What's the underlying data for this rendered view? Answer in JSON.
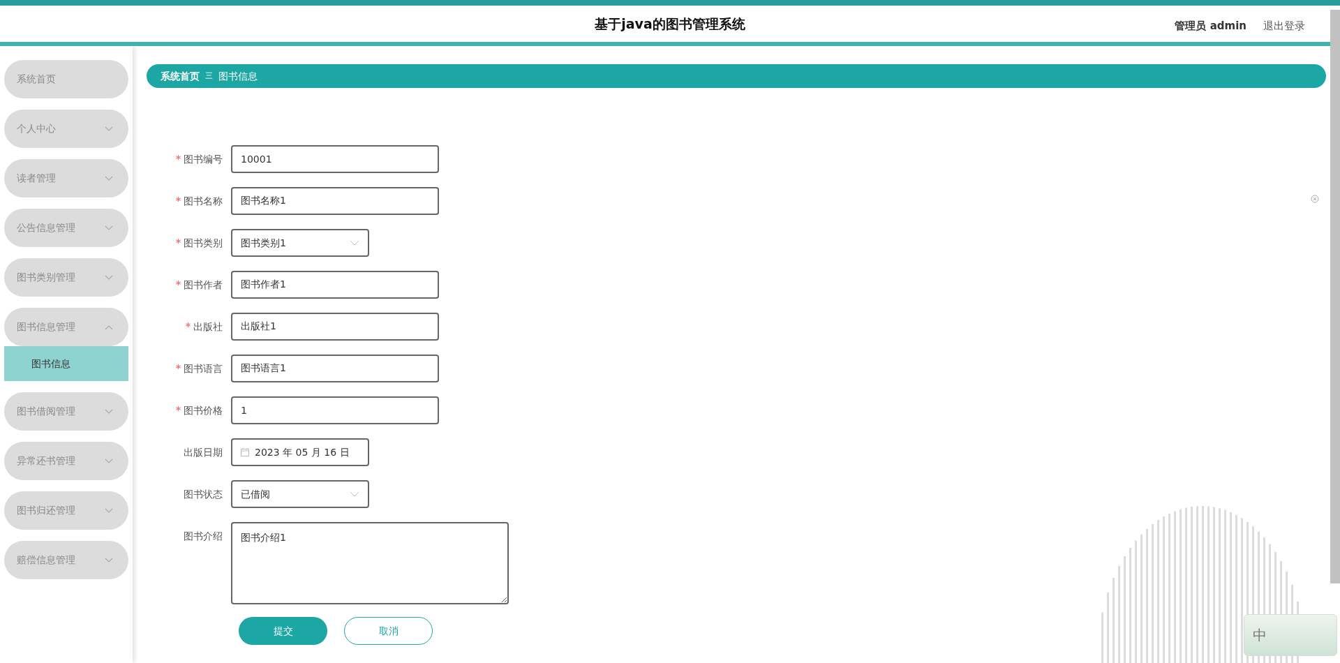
{
  "header": {
    "title": "基于java的图书管理系统",
    "user": "管理员 admin",
    "logout": "退出登录"
  },
  "sidebar": {
    "items": [
      {
        "label": "系统首页",
        "kind": "link"
      },
      {
        "label": "个人中心",
        "kind": "menu",
        "expanded": false
      },
      {
        "label": "读者管理",
        "kind": "menu",
        "expanded": false
      },
      {
        "label": "公告信息管理",
        "kind": "menu",
        "expanded": false
      },
      {
        "label": "图书类别管理",
        "kind": "menu",
        "expanded": false
      },
      {
        "label": "图书信息管理",
        "kind": "menu",
        "expanded": true,
        "children": [
          {
            "label": "图书信息",
            "selected": true
          }
        ]
      },
      {
        "label": "图书借阅管理",
        "kind": "menu",
        "expanded": false
      },
      {
        "label": "异常还书管理",
        "kind": "menu",
        "expanded": false
      },
      {
        "label": "图书归还管理",
        "kind": "menu",
        "expanded": false
      },
      {
        "label": "赔偿信息管理",
        "kind": "menu",
        "expanded": false
      }
    ]
  },
  "breadcrumb": {
    "home": "系统首页",
    "separator": "三",
    "current": "图书信息"
  },
  "form": {
    "fields": [
      {
        "label": "图书编号",
        "required": true,
        "kind": "text",
        "value": "10001"
      },
      {
        "label": "图书名称",
        "required": true,
        "kind": "text",
        "value": "图书名称1"
      },
      {
        "label": "图书类别",
        "required": true,
        "kind": "select",
        "value": "图书类别1"
      },
      {
        "label": "图书作者",
        "required": true,
        "kind": "text",
        "value": "图书作者1"
      },
      {
        "label": "出版社",
        "required": true,
        "kind": "text",
        "value": "出版社1"
      },
      {
        "label": "图书语言",
        "required": true,
        "kind": "text",
        "value": "图书语言1"
      },
      {
        "label": "图书价格",
        "required": true,
        "kind": "text",
        "value": "1"
      },
      {
        "label": "出版日期",
        "required": false,
        "kind": "date",
        "value": "2023 年 05 月 16 日"
      },
      {
        "label": "图书状态",
        "required": false,
        "kind": "select",
        "value": "已借阅"
      },
      {
        "label": "图书介绍",
        "required": false,
        "kind": "textarea",
        "value": "图书介绍1"
      }
    ],
    "buttons": [
      {
        "label": "提交",
        "kind": "primary"
      },
      {
        "label": "取消",
        "kind": "outline"
      }
    ]
  },
  "ime": {
    "label": "中"
  }
}
